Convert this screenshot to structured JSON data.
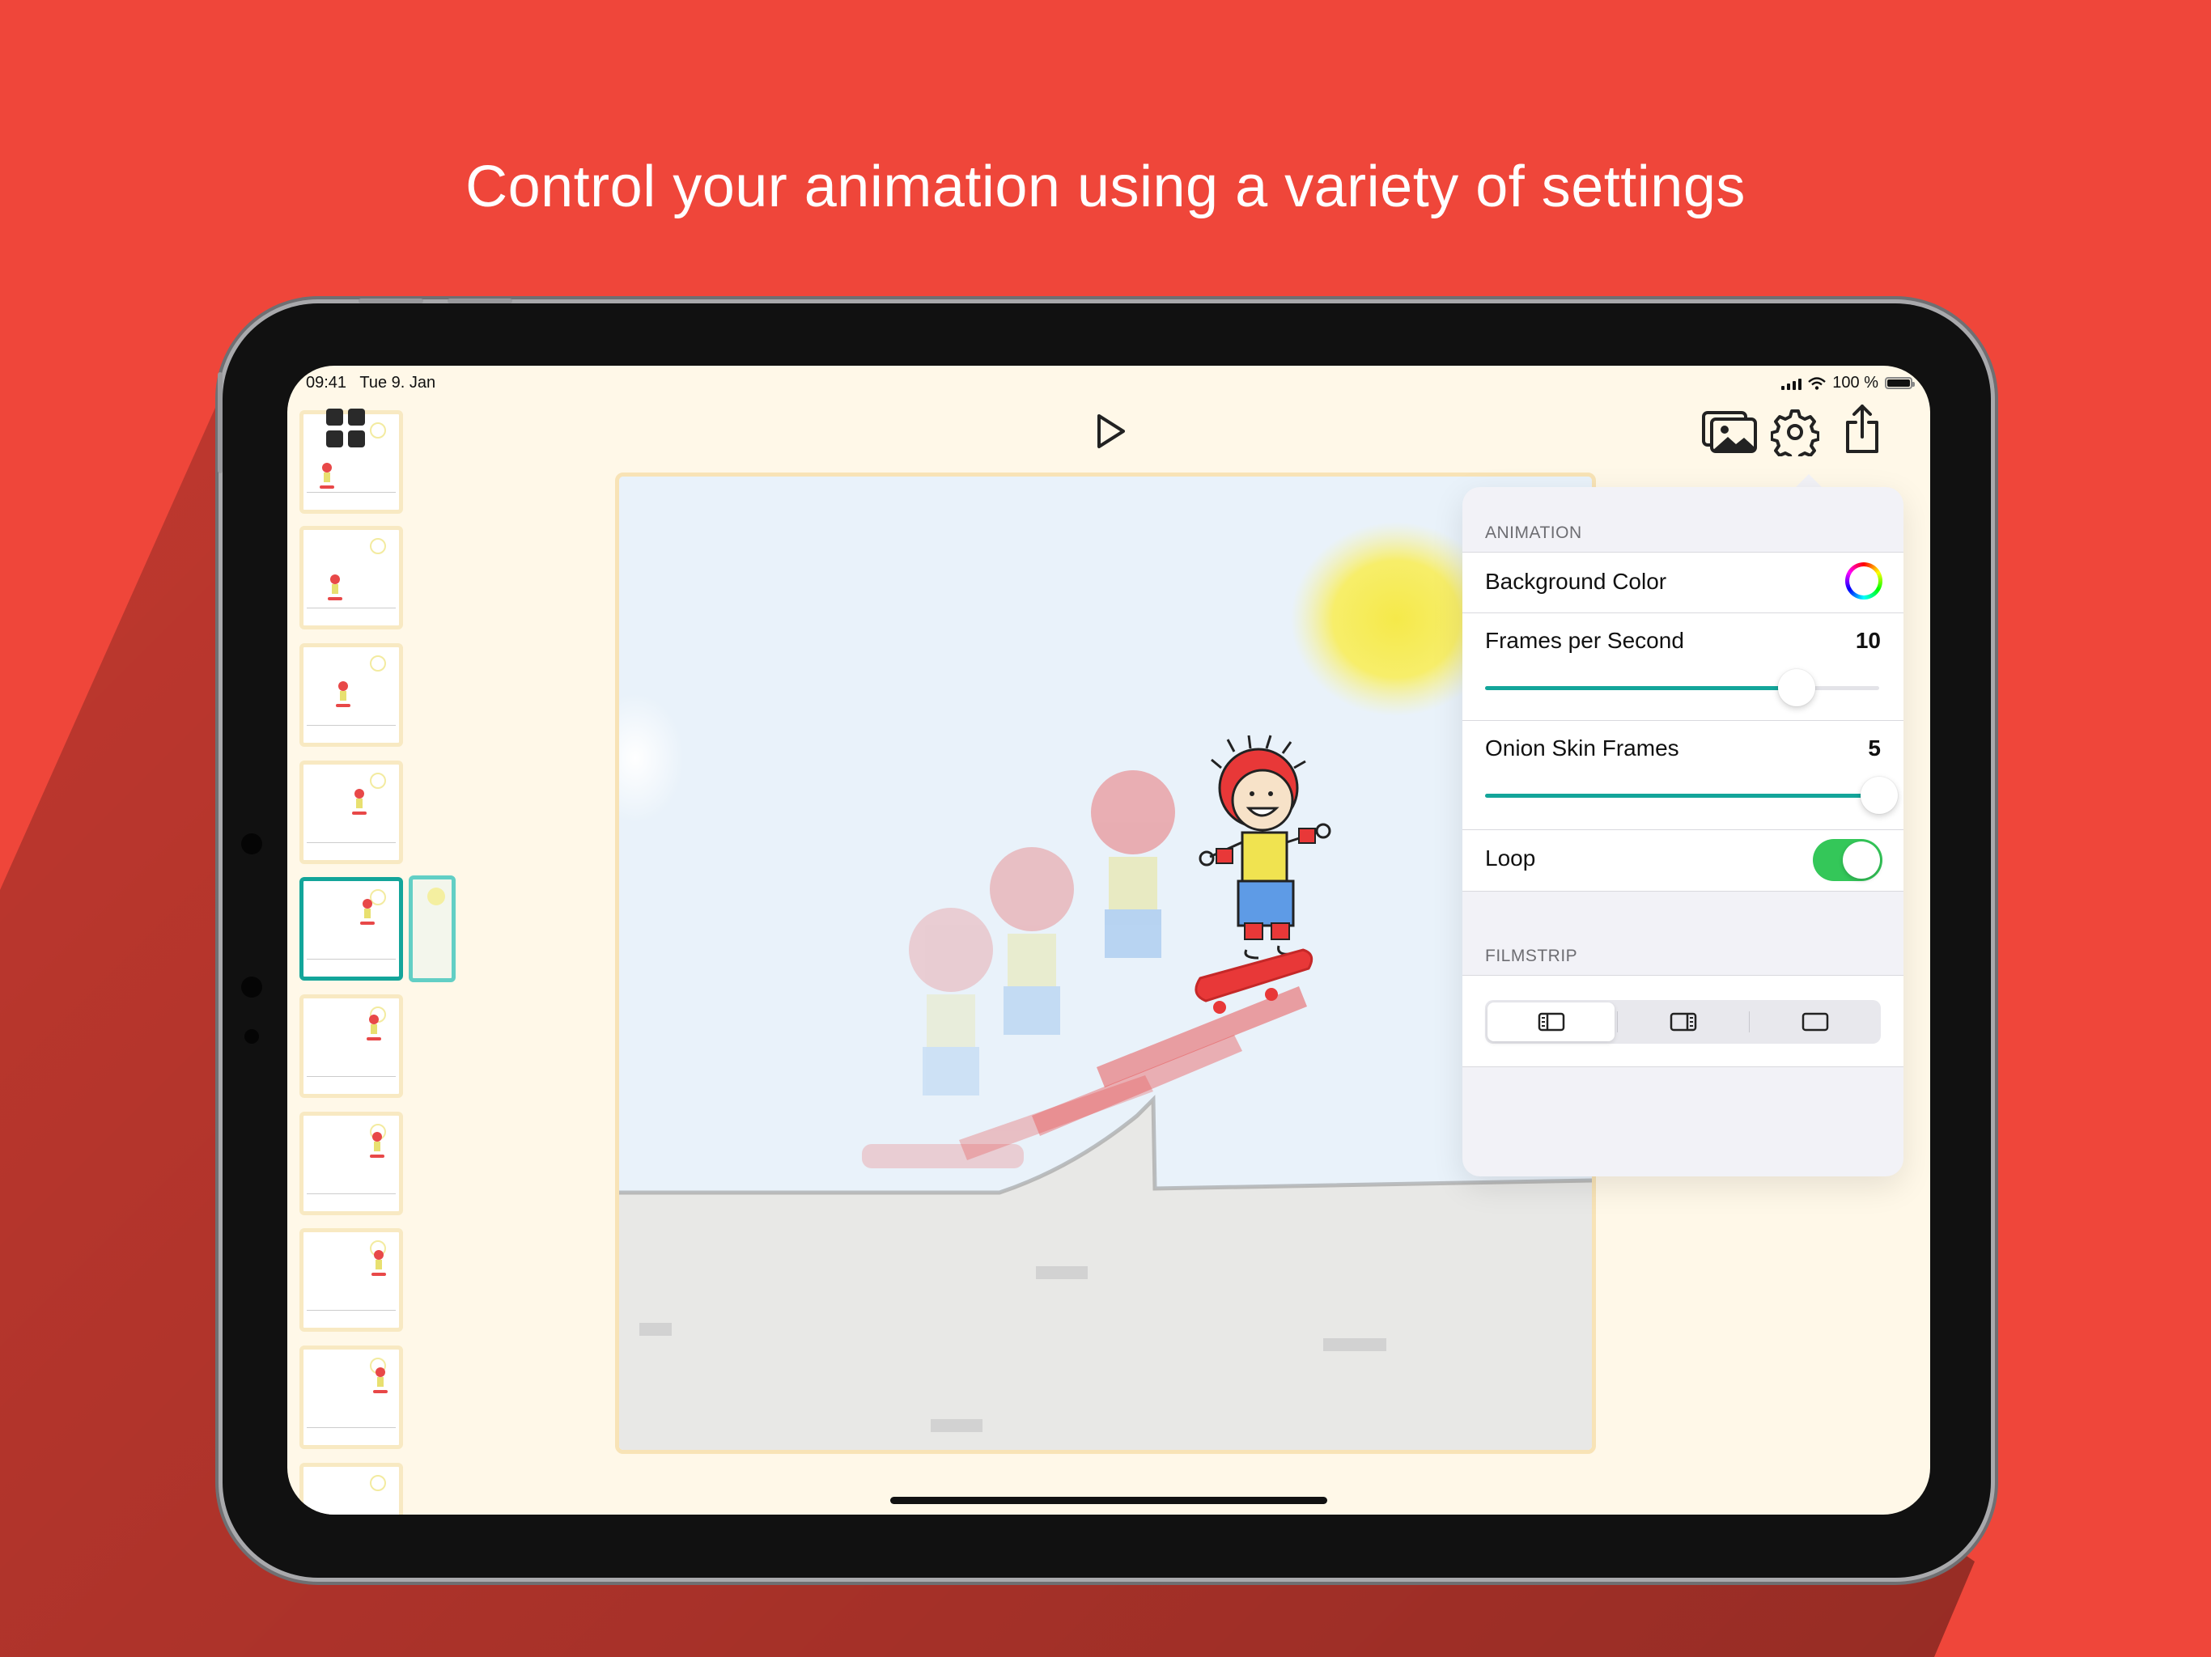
{
  "headline": "Control your animation using a variety of settings",
  "status_bar": {
    "time": "09:41",
    "date": "Tue 9. Jan",
    "battery": "100 %"
  },
  "toolbar": {
    "gallery_icon": "photo-stack-icon",
    "settings_icon": "gear-icon",
    "share_icon": "share-icon",
    "play_icon": "play-icon",
    "frames_icon": "grid-icon"
  },
  "filmstrip": {
    "selected_frame_index": 4
  },
  "settings": {
    "animation_section": "ANIMATION",
    "background_color_label": "Background Color",
    "fps_label": "Frames per Second",
    "fps_value": "10",
    "fps_fraction": 0.79,
    "onion_label": "Onion Skin Frames",
    "onion_value": "5",
    "onion_fraction": 1.0,
    "loop_label": "Loop",
    "loop_on": true,
    "filmstrip_section": "FILMSTRIP",
    "filmstrip_options": [
      "left-sidebar-icon",
      "right-sidebar-icon",
      "no-sidebar-icon"
    ],
    "filmstrip_selected": 0
  },
  "colors": {
    "background": "#EF463A",
    "accent_teal": "#13A59A",
    "toggle_green": "#34C759",
    "canvas_frame": "#FFF8E8"
  }
}
